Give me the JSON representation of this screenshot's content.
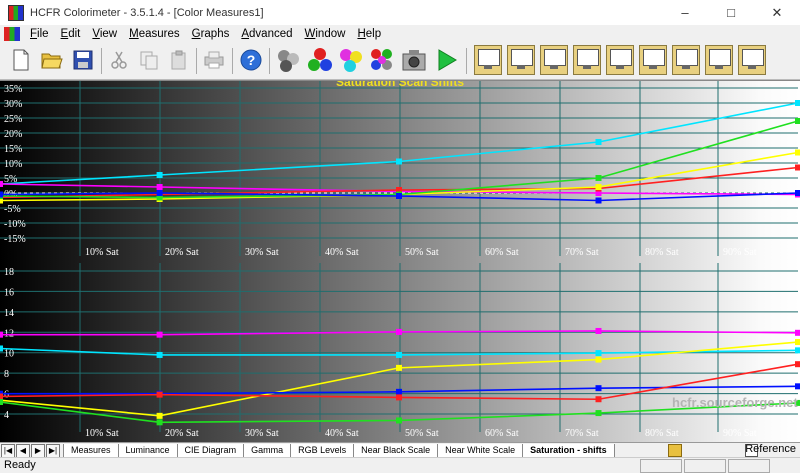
{
  "window": {
    "title": "HCFR Colorimeter - 3.5.1.4 - [Color Measures1]"
  },
  "menu": {
    "items": [
      {
        "u": "F",
        "rest": "ile"
      },
      {
        "u": "E",
        "rest": "dit"
      },
      {
        "u": "V",
        "rest": "iew"
      },
      {
        "u": "M",
        "rest": "easures"
      },
      {
        "u": "G",
        "rest": "raphs"
      },
      {
        "u": "A",
        "rest": "dvanced"
      },
      {
        "u": "W",
        "rest": "indow"
      },
      {
        "u": "H",
        "rest": "elp"
      }
    ]
  },
  "chart_data": [
    {
      "type": "line",
      "title": "Saturation Scan Shifts",
      "x_labels": [
        "10% Sat",
        "20% Sat",
        "30% Sat",
        "40% Sat",
        "50% Sat",
        "60% Sat",
        "70% Sat",
        "80% Sat",
        "90% Sat"
      ],
      "y_ticks": [
        "35%",
        "30%",
        "25%",
        "20%",
        "15%",
        "10%",
        "5%",
        "0%",
        "-5%",
        "-10%",
        "-15%"
      ],
      "ylim": [
        -15,
        35
      ],
      "x": [
        0,
        20,
        50,
        75,
        100
      ],
      "series": [
        {
          "color": "#00e5ff",
          "values": [
            3,
            6,
            10.5,
            17,
            30
          ]
        },
        {
          "color": "#ff00ff",
          "values": [
            3,
            2,
            0.5,
            0,
            -0.5
          ]
        },
        {
          "color": "#ff2020",
          "values": [
            -1.5,
            -0.5,
            1,
            1.5,
            8.5
          ]
        },
        {
          "color": "#ffff00",
          "values": [
            -2.5,
            -2,
            -0.5,
            2,
            13.5
          ]
        },
        {
          "color": "#20e020",
          "values": [
            -1,
            -1.5,
            -0.5,
            5,
            24
          ]
        },
        {
          "color": "#0010ff",
          "values": [
            -0.5,
            0,
            -1,
            -2.5,
            0
          ]
        }
      ]
    },
    {
      "type": "line",
      "x_labels": [
        "10% Sat",
        "20% Sat",
        "30% Sat",
        "40% Sat",
        "50% Sat",
        "60% Sat",
        "70% Sat",
        "80% Sat",
        "90% Sat"
      ],
      "y_ticks": [
        "18",
        "16",
        "14",
        "12",
        "10",
        "8",
        "6",
        "4"
      ],
      "ylim": [
        2.5,
        18
      ],
      "x": [
        0,
        20,
        50,
        75,
        100
      ],
      "series": [
        {
          "color": "#ff00ff",
          "values": [
            11.1,
            11.1,
            11.4,
            11.5,
            11.3
          ]
        },
        {
          "color": "#00e5ff",
          "values": [
            9.6,
            8.9,
            8.9,
            9.1,
            9.4
          ]
        },
        {
          "color": "#ffff00",
          "values": [
            4.0,
            2.3,
            7.5,
            8.4,
            10.3
          ]
        },
        {
          "color": "#0010ff",
          "values": [
            4.7,
            4.7,
            4.9,
            5.3,
            5.5
          ]
        },
        {
          "color": "#ff2020",
          "values": [
            4.4,
            4.6,
            4.3,
            4.1,
            7.9
          ]
        },
        {
          "color": "#20e020",
          "values": [
            3.8,
            1.6,
            1.8,
            2.6,
            3.7
          ]
        }
      ]
    }
  ],
  "watermark": "hcfr.sourceforge.net",
  "sheet_tabs": [
    "Measures",
    "Luminance",
    "CIE Diagram",
    "Gamma",
    "RGB Levels",
    "Near Black Scale",
    "Near White Scale",
    "Saturation - shifts"
  ],
  "reference": {
    "label": "Reference"
  },
  "status": {
    "text": "Ready"
  }
}
